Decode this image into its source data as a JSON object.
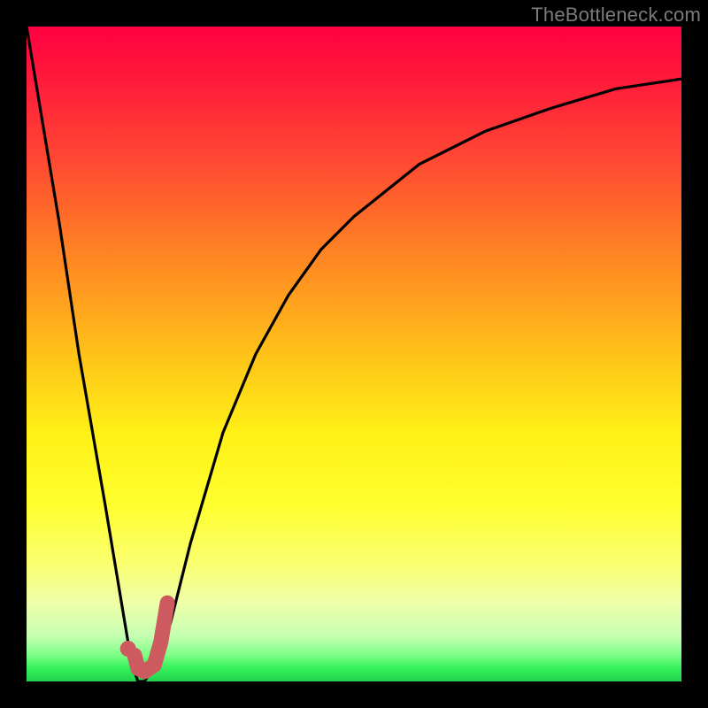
{
  "watermark": "TheBottleneck.com",
  "chart_data": {
    "type": "line",
    "title": "",
    "xlabel": "",
    "ylabel": "",
    "xlim": [
      0,
      100
    ],
    "ylim": [
      0,
      100
    ],
    "grid": false,
    "series": [
      {
        "name": "bottleneck-curve",
        "x": [
          0,
          2,
          5,
          8,
          12,
          15,
          16,
          17,
          18,
          20,
          22,
          25,
          30,
          35,
          40,
          45,
          50,
          60,
          70,
          80,
          90,
          100
        ],
        "y": [
          100,
          88,
          70,
          50,
          27,
          9,
          3,
          0,
          0,
          3,
          9,
          21,
          38,
          50,
          59,
          66,
          71,
          79,
          84,
          87.5,
          90.5,
          92
        ]
      }
    ],
    "marker": {
      "name": "selected-hardware",
      "color": "#cc5a5f",
      "dot": {
        "x": 15.5,
        "y": 5
      },
      "hook": [
        {
          "x": 16.5,
          "y": 4
        },
        {
          "x": 17.0,
          "y": 2
        },
        {
          "x": 18.0,
          "y": 1.5
        },
        {
          "x": 19.5,
          "y": 2.5
        },
        {
          "x": 20.5,
          "y": 6
        },
        {
          "x": 21.5,
          "y": 12
        }
      ]
    }
  },
  "gradient_stops": [
    {
      "pos": 0,
      "color": "#ff0040"
    },
    {
      "pos": 0.5,
      "color": "#ffe018"
    },
    {
      "pos": 0.9,
      "color": "#d8ffb0"
    },
    {
      "pos": 1.0,
      "color": "#22d34d"
    }
  ]
}
